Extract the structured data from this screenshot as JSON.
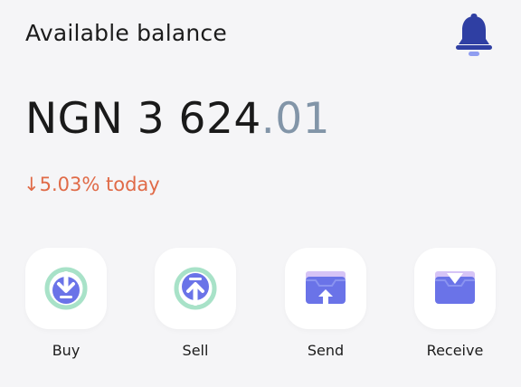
{
  "header": {
    "label": "Available balance",
    "bell_icon": "bell-icon"
  },
  "balance": {
    "currency": "NGN",
    "whole": "3 624",
    "decimal": ".01"
  },
  "change": {
    "direction": "down",
    "text": "5.03% today",
    "color": "#e06a47"
  },
  "actions": [
    {
      "label": "Buy",
      "icon": "download-circle-icon"
    },
    {
      "label": "Sell",
      "icon": "upload-circle-icon"
    },
    {
      "label": "Send",
      "icon": "wallet-send-icon"
    },
    {
      "label": "Receive",
      "icon": "wallet-receive-icon"
    }
  ],
  "colors": {
    "accent": "#2f3fa3",
    "icon_primary": "#6a73e8",
    "icon_ring": "#a8e2c8",
    "negative": "#e06a47",
    "muted_decimal": "#8295a8"
  }
}
